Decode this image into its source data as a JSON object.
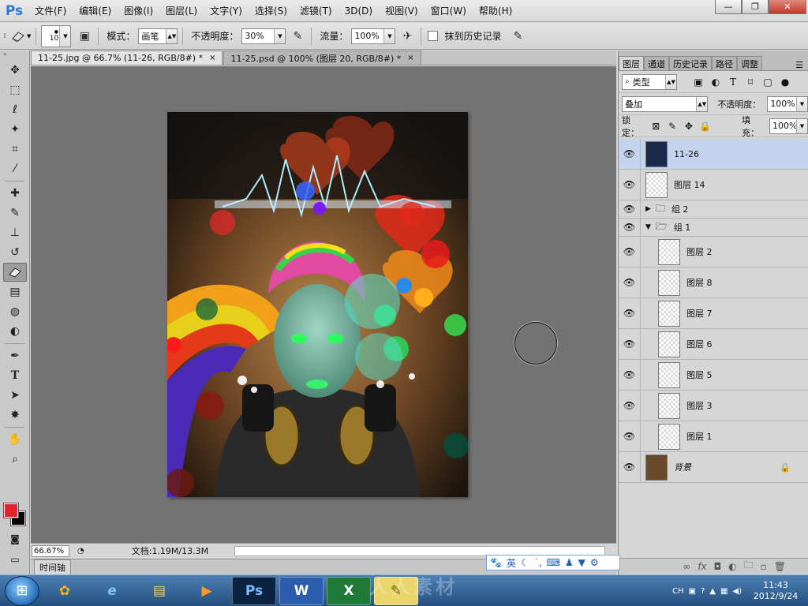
{
  "app": {
    "logo": "Ps",
    "menu": [
      "文件(F)",
      "编辑(E)",
      "图像(I)",
      "图层(L)",
      "文字(Y)",
      "选择(S)",
      "滤镜(T)",
      "3D(D)",
      "视图(V)",
      "窗口(W)",
      "帮助(H)"
    ],
    "window_buttons": {
      "minimize": "—",
      "restore": "❐",
      "close": "✕"
    }
  },
  "options": {
    "brush_size": "100",
    "mode_label": "模式：",
    "mode_value": "画笔",
    "opacity_label": "不透明度：",
    "opacity_value": "30%",
    "flow_label": "流量：",
    "flow_value": "100%",
    "history_label": "抹到历史记录"
  },
  "tabs": [
    {
      "label": "11-25.jpg @ 66.7% (11-26, RGB/8#) *",
      "close": "×",
      "active": true
    },
    {
      "label": "11-25.psd @ 100% (图层 20, RGB/8#) *",
      "close": "×",
      "active": false
    }
  ],
  "status": {
    "zoom": "66.67%",
    "doc_size": "文档:1.19M/13.3M",
    "timeline_label": "时间轴"
  },
  "ime": {
    "lang": "英",
    "icons": [
      "paw-icon",
      "moon-icon",
      "punctuation-icon",
      "keyboard-icon",
      "user-icon",
      "shirt-icon",
      "gear-icon"
    ]
  },
  "panel": {
    "tabs": [
      "图层",
      "通道",
      "历史记录",
      "路径",
      "调整"
    ],
    "filter_kind": "类型",
    "blend_mode": "叠加",
    "opacity_label": "不透明度：",
    "opacity_value": "100%",
    "lock_label": "锁定：",
    "fill_label": "填充：",
    "fill_value": "100%",
    "layers": [
      {
        "name": "11-26",
        "type": "layer",
        "selected": true
      },
      {
        "name": "图层 14",
        "type": "layer"
      },
      {
        "name": "组 2",
        "type": "group",
        "expanded": false
      },
      {
        "name": "组 1",
        "type": "group",
        "expanded": true
      },
      {
        "name": "图层 2",
        "type": "layer",
        "indent": true
      },
      {
        "name": "图层 8",
        "type": "layer",
        "indent": true
      },
      {
        "name": "图层 7",
        "type": "layer",
        "indent": true
      },
      {
        "name": "图层 6",
        "type": "layer",
        "indent": true
      },
      {
        "name": "图层 5",
        "type": "layer",
        "indent": true
      },
      {
        "name": "图层 3",
        "type": "layer",
        "indent": true
      },
      {
        "name": "图层 1",
        "type": "layer",
        "indent": true
      },
      {
        "name": "背景",
        "type": "background",
        "locked": true
      }
    ],
    "footer_icons": [
      "link-icon",
      "fx-icon",
      "mask-icon",
      "adjustment-icon",
      "folder-icon",
      "new-layer-icon",
      "trash-icon"
    ]
  },
  "colors": {
    "foreground": "#e8222a",
    "background": "#000000",
    "selected_layer": "#c4d4ec"
  },
  "taskbar": {
    "apps": [
      "paint-icon",
      "ie-icon",
      "explorer-icon",
      "media-icon",
      "Ps",
      "W",
      "excel-icon",
      "notes-icon"
    ],
    "tray": {
      "lang": "CH",
      "time": "11:43",
      "date": "2012/9/24"
    }
  },
  "watermark": "人人素材"
}
